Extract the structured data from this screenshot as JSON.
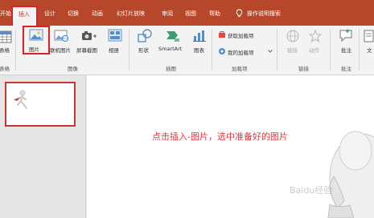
{
  "tabs": [
    {
      "label": "开始"
    },
    {
      "label": "插入"
    },
    {
      "label": "设计"
    },
    {
      "label": "切换"
    },
    {
      "label": "动画"
    },
    {
      "label": "幻灯片放映"
    },
    {
      "label": "审阅"
    },
    {
      "label": "视图"
    },
    {
      "label": "帮助"
    }
  ],
  "tell_me": "操作说明搜索",
  "ribbon": {
    "table_label": "表格",
    "table_group": "表格",
    "picture_label": "图片",
    "online_picture_label": "联机图片",
    "screenshot_label": "屏幕截图",
    "album_label": "相册",
    "images_group": "图像",
    "shapes_label": "形状",
    "smartart_label": "SmartArt",
    "chart_label": "图表",
    "illustrations_group": "插图",
    "get_addins_label": "获取加载项",
    "my_addins_label": "我的加载项",
    "addins_group": "加载项",
    "link_label": "链接",
    "action_label": "动作",
    "links_group": "链接",
    "comment_label": "批注",
    "comments_group": "批注",
    "text_label": "文"
  },
  "slide": {
    "annotation": "点击插入-图片，选中准备好的图片"
  },
  "watermark": "Baidu经验",
  "colors": {
    "accent": "#b7472a",
    "highlight_border": "#e02020",
    "annotation": "#e8363c"
  }
}
